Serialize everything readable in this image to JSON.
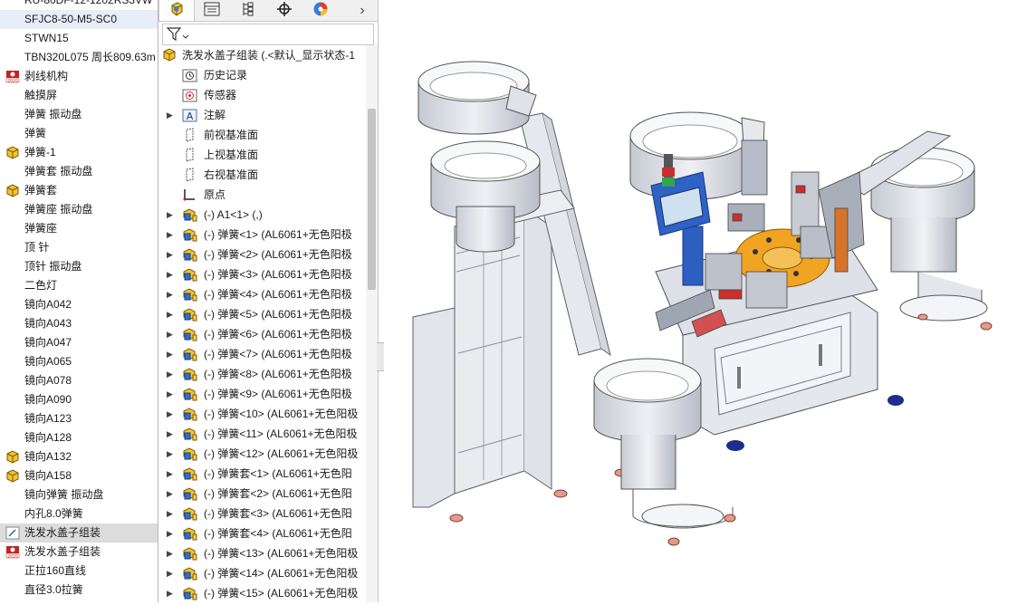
{
  "left_list": {
    "items": [
      {
        "label": "RU-80DF-12-1202RS3VW",
        "icon": "none"
      },
      {
        "label": "SFJC8-50-M5-SC0",
        "icon": "none",
        "state": "highlighted"
      },
      {
        "label": "STWN15",
        "icon": "none"
      },
      {
        "label": "TBN320L075 周长809.63m",
        "icon": "none"
      },
      {
        "label": "剥线机构",
        "icon": "assembly-2020-icon"
      },
      {
        "label": "触摸屏",
        "icon": "none"
      },
      {
        "label": "弹簧  振动盘",
        "icon": "none"
      },
      {
        "label": "弹簧",
        "icon": "none"
      },
      {
        "label": "弹簧-1",
        "icon": "assembly-icon"
      },
      {
        "label": "弹簧套  振动盘",
        "icon": "none"
      },
      {
        "label": "弹簧套",
        "icon": "assembly-icon"
      },
      {
        "label": "弹簧座 振动盘",
        "icon": "none"
      },
      {
        "label": "弹簧座",
        "icon": "none"
      },
      {
        "label": "顶 针",
        "icon": "none"
      },
      {
        "label": "顶针  振动盘",
        "icon": "none"
      },
      {
        "label": "二色灯",
        "icon": "none"
      },
      {
        "label": "镜向A042",
        "icon": "none"
      },
      {
        "label": "镜向A043",
        "icon": "none"
      },
      {
        "label": "镜向A047",
        "icon": "none"
      },
      {
        "label": "镜向A065",
        "icon": "none"
      },
      {
        "label": "镜向A078",
        "icon": "none"
      },
      {
        "label": "镜向A090",
        "icon": "none"
      },
      {
        "label": "镜向A123",
        "icon": "none"
      },
      {
        "label": "镜向A128",
        "icon": "none"
      },
      {
        "label": "镜向A132",
        "icon": "assembly-icon"
      },
      {
        "label": "镜向A158",
        "icon": "assembly-icon"
      },
      {
        "label": "镜向弹簧  振动盘",
        "icon": "none"
      },
      {
        "label": "内孔8.0弹簧",
        "icon": "none"
      },
      {
        "label": "洗发水盖子组装",
        "icon": "drawing-icon",
        "state": "selected"
      },
      {
        "label": "洗发水盖子组装",
        "icon": "assembly-2020-icon"
      },
      {
        "label": "正拉160直线",
        "icon": "none"
      },
      {
        "label": "直径3.0拉簧",
        "icon": "none"
      }
    ]
  },
  "feature_manager": {
    "tabs": [
      {
        "name": "feature-tree",
        "icon": "assembly-tab-icon"
      },
      {
        "name": "property",
        "icon": "property-manager-icon"
      },
      {
        "name": "configuration",
        "icon": "configuration-manager-icon"
      },
      {
        "name": "dimxpert",
        "icon": "dimxpert-icon"
      },
      {
        "name": "display",
        "icon": "display-manager-icon"
      }
    ],
    "more_tabs_glyph": "›",
    "root_label": "洗发水盖子组装  (.<默认_显示状态-1",
    "items": [
      {
        "label": "历史记录",
        "icon": "history-icon",
        "expand": false,
        "indent": 1
      },
      {
        "label": "传感器",
        "icon": "sensor-icon",
        "expand": false,
        "indent": 1
      },
      {
        "label": "注解",
        "icon": "annotation-icon",
        "expand": true,
        "indent": 1
      },
      {
        "label": "前视基准面",
        "icon": "plane-icon",
        "expand": false,
        "indent": 1
      },
      {
        "label": "上视基准面",
        "icon": "plane-icon",
        "expand": false,
        "indent": 1
      },
      {
        "label": "右视基准面",
        "icon": "plane-icon",
        "expand": false,
        "indent": 1
      },
      {
        "label": "原点",
        "icon": "origin-icon",
        "expand": false,
        "indent": 1
      },
      {
        "label": "(-) A1<1> (,)",
        "icon": "subassembly-icon",
        "expand": true,
        "indent": 1
      },
      {
        "label": "(-) 弹簧<1>  (AL6061+无色阳极",
        "icon": "subassembly-icon",
        "expand": true,
        "indent": 1
      },
      {
        "label": "(-) 弹簧<2>  (AL6061+无色阳极",
        "icon": "subassembly-icon",
        "expand": true,
        "indent": 1
      },
      {
        "label": "(-) 弹簧<3>  (AL6061+无色阳极",
        "icon": "subassembly-icon",
        "expand": true,
        "indent": 1
      },
      {
        "label": "(-) 弹簧<4>  (AL6061+无色阳极",
        "icon": "subassembly-icon",
        "expand": true,
        "indent": 1
      },
      {
        "label": "(-) 弹簧<5>  (AL6061+无色阳极",
        "icon": "subassembly-icon",
        "expand": true,
        "indent": 1
      },
      {
        "label": "(-) 弹簧<6>  (AL6061+无色阳极",
        "icon": "subassembly-icon",
        "expand": true,
        "indent": 1
      },
      {
        "label": "(-) 弹簧<7>  (AL6061+无色阳极",
        "icon": "subassembly-icon",
        "expand": true,
        "indent": 1
      },
      {
        "label": "(-) 弹簧<8>  (AL6061+无色阳极",
        "icon": "subassembly-icon",
        "expand": true,
        "indent": 1
      },
      {
        "label": "(-) 弹簧<9>  (AL6061+无色阳极",
        "icon": "subassembly-icon",
        "expand": true,
        "indent": 1
      },
      {
        "label": "(-) 弹簧<10>  (AL6061+无色阳极",
        "icon": "subassembly-icon",
        "expand": true,
        "indent": 1
      },
      {
        "label": "(-) 弹簧<11>  (AL6061+无色阳极",
        "icon": "subassembly-icon",
        "expand": true,
        "indent": 1
      },
      {
        "label": "(-) 弹簧<12>  (AL6061+无色阳极",
        "icon": "subassembly-icon",
        "expand": true,
        "indent": 1
      },
      {
        "label": "(-) 弹簧套<1>  (AL6061+无色阳",
        "icon": "subassembly-icon",
        "expand": true,
        "indent": 1
      },
      {
        "label": "(-) 弹簧套<2>  (AL6061+无色阳",
        "icon": "subassembly-icon",
        "expand": true,
        "indent": 1
      },
      {
        "label": "(-) 弹簧套<3>  (AL6061+无色阳",
        "icon": "subassembly-icon",
        "expand": true,
        "indent": 1
      },
      {
        "label": "(-) 弹簧套<4>  (AL6061+无色阳",
        "icon": "subassembly-icon",
        "expand": true,
        "indent": 1
      },
      {
        "label": "(-) 弹簧<13>  (AL6061+无色阳极",
        "icon": "subassembly-icon",
        "expand": true,
        "indent": 1
      },
      {
        "label": "(-) 弹簧<14>  (AL6061+无色阳极",
        "icon": "subassembly-icon",
        "expand": true,
        "indent": 1
      },
      {
        "label": "(-) 弹簧<15>  (AL6061+无色阳极",
        "icon": "subassembly-icon",
        "expand": true,
        "indent": 1
      }
    ]
  },
  "viewport": {
    "content": "3d-model-assembly-machine",
    "colors": {
      "frame": "#9aa0ab",
      "bowl": "#d8dbe2",
      "turntable": "#f0a422",
      "panel": "#2f62b8",
      "feet": "#1a2f8a",
      "pads": "#e0a090",
      "highlight_red": "#cc2d2d"
    }
  }
}
